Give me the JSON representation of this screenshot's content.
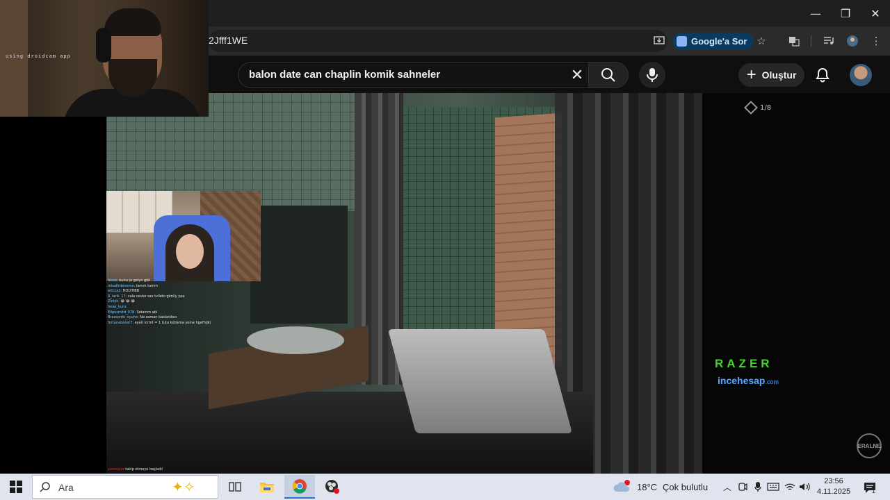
{
  "browser": {
    "url_fragment": "2Jfff1WE",
    "ask_google": "Google'a Sor",
    "window_controls": {
      "minimize": "—",
      "restore": "❐",
      "close": "✕"
    }
  },
  "youtube": {
    "search_query": "balon date can chaplin komik sahneler",
    "create_label": "Oluştur",
    "clear_glyph": "✕"
  },
  "video": {
    "hud_count": "1/8",
    "sponsor_brand": "RAZER",
    "sponsor_site_main": "incehesap",
    "sponsor_site_tld": ".com",
    "watermark_badge": "ERALNE"
  },
  "webcam": {
    "caption": "using droidcam app"
  },
  "stream_chat": {
    "messages": [
      {
        "user": "Noob:",
        "text": "bunu ja gelyn gibi"
      },
      {
        "user": "misafirdeneme:",
        "text": "tamm tamm"
      },
      {
        "user": "ali11x2:",
        "text": "HOLYHBB"
      },
      {
        "user": "R_larik_17:",
        "text": "cala cevke sax tvlleto gimily yee"
      },
      {
        "user": "Zlolyk:",
        "text": "😂 😂 😂"
      },
      {
        "user": "heap_kuru:",
        "text": ""
      },
      {
        "user": "Ellpusmitd_078:",
        "text": "Selamm abi"
      },
      {
        "user": "Brasserdo_oyuhe:",
        "text": "Ne zaman baslanilecı"
      },
      {
        "user": "fortunaboost7:",
        "text": "eyeri lcrmt = 1 tutu kotlama yoine hgefhijki"
      }
    ],
    "follow_user": "xxxxxxxx",
    "follow_text": "takip etmeye başladı!"
  },
  "taskbar": {
    "search_placeholder": "Ara",
    "weather_temp": "18°C",
    "weather_desc": "Çok bulutlu",
    "time": "23:56",
    "date": "4.11.2025",
    "notification_count": "1"
  }
}
